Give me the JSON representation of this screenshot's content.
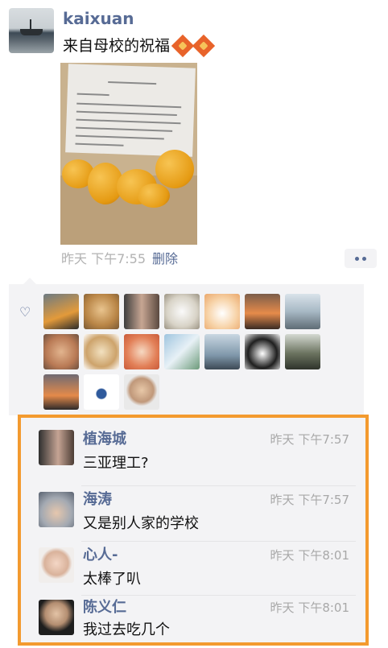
{
  "post": {
    "author": "kaixuan",
    "text": "来自母校的祝福",
    "time": "昨天 下午7:55",
    "delete_label": "删除"
  },
  "likes": {
    "icon": "heart-outline-icon",
    "count_shown": 17
  },
  "comments": [
    {
      "name": "植海城",
      "time": "昨天 下午7:57",
      "text": "三亚理工?"
    },
    {
      "name": "海涛",
      "time": "昨天 下午7:57",
      "text": "又是别人家的学校"
    },
    {
      "name": "心人-",
      "time": "昨天 下午8:01",
      "text": "太棒了叭"
    },
    {
      "name": "陈义仁",
      "time": "昨天 下午8:01",
      "text": "我过去吃几个"
    }
  ],
  "colors": {
    "link": "#576b95",
    "highlight_border": "#f39a2f",
    "panel_bg": "#f3f3f5"
  }
}
